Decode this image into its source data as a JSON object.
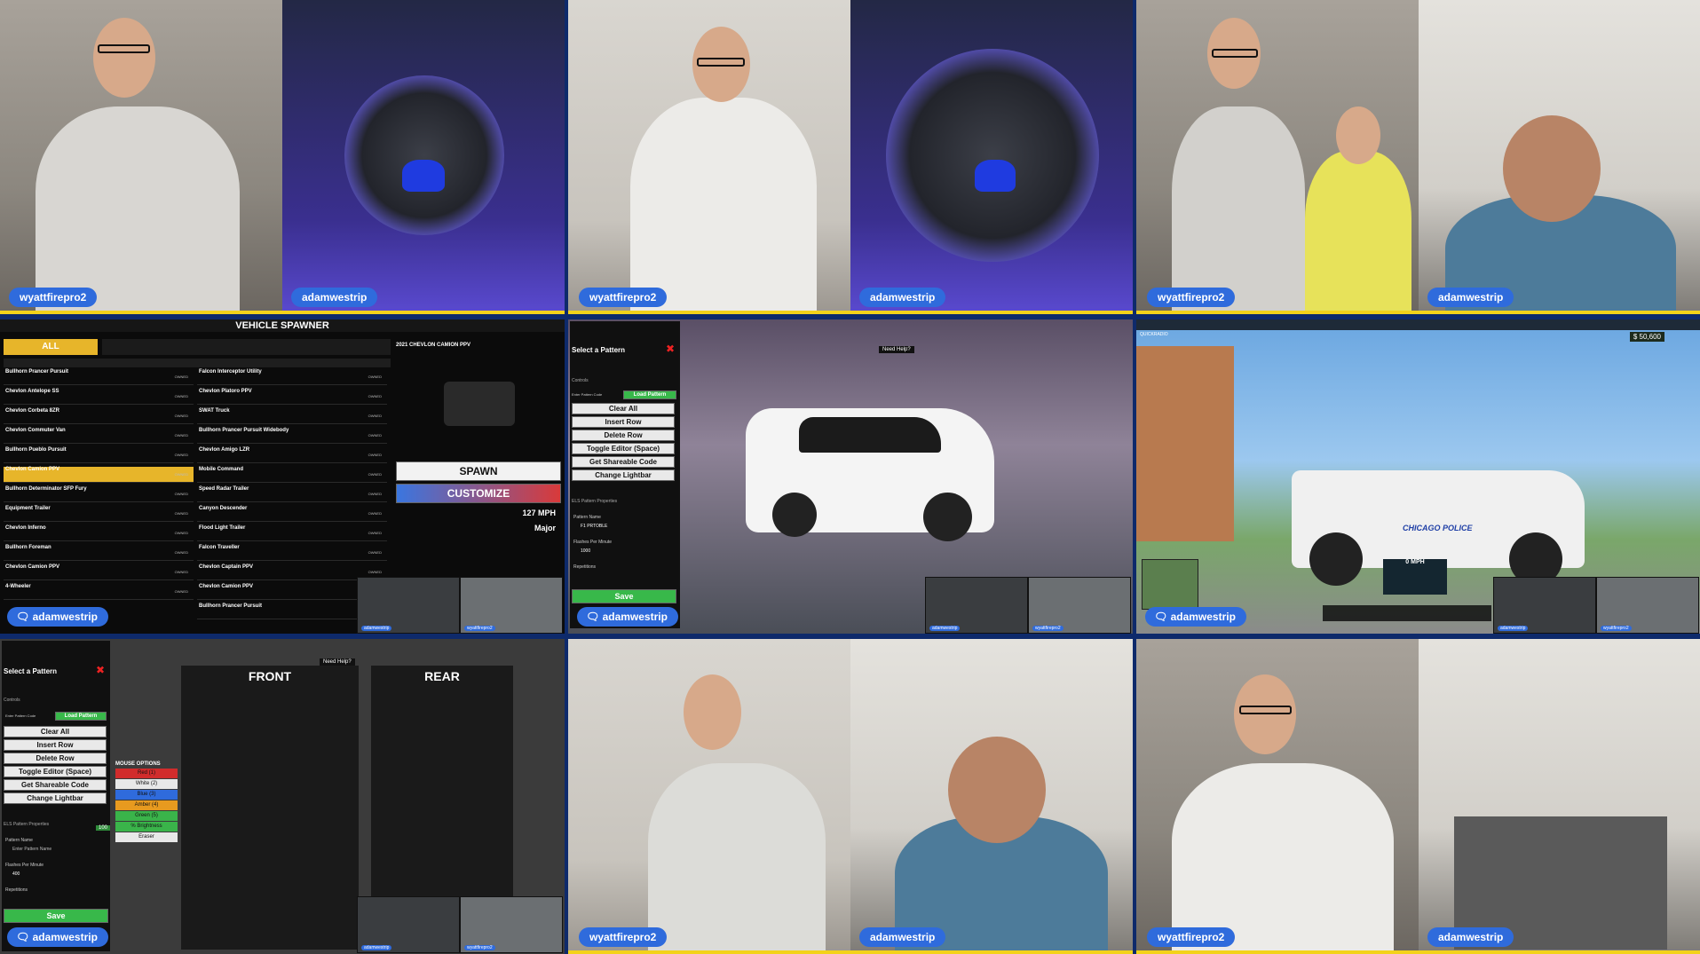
{
  "participants": {
    "p1": "wyattfirepro2",
    "p2": "adamwestrip"
  },
  "spawner": {
    "title": "VEHICLE SPAWNER",
    "tab_all": "ALL",
    "selected_vehicle": "2021 CHEVLON CAMION PPV",
    "spawn_label": "SPAWN",
    "customize_label": "CUSTOMIZE",
    "speed": "127 MPH",
    "class": "Major",
    "owned": "OWNED",
    "left_list": [
      "Bullhorn Prancer Pursuit",
      "Chevlon Antelope SS",
      "Chevlon Corbeta 8ZR",
      "Chevlon Commuter Van",
      "Bullhorn Pueblo Pursuit",
      "Chevlon Camion PPV",
      "Bullhorn Determinator SFP Fury",
      "Equipment Trailer",
      "Chevlon Inferno",
      "Bullhorn Foreman",
      "Chevlon Camion PPV",
      "4-Wheeler"
    ],
    "right_list": [
      "Falcon Interceptor Utility",
      "Chevlon Platoro PPV",
      "SWAT Truck",
      "Bullhorn Prancer Pursuit Widebody",
      "Chevlon Amigo LZR",
      "Mobile Command",
      "Speed Radar Trailer",
      "Canyon Descender",
      "Flood Light Trailer",
      "Falcon Traveller",
      "Chevlon Captain PPV",
      "Chevlon Camion PPV",
      "Bullhorn Prancer Pursuit"
    ]
  },
  "pattern": {
    "select_title": "Select a Pattern",
    "controls": "Controls",
    "enter_code": "Enter Pattern Code",
    "load_pattern": "Load Pattern",
    "buttons": [
      "Clear All",
      "Insert Row",
      "Delete Row",
      "Toggle Editor (Space)",
      "Get Shareable Code",
      "Change Lightbar"
    ],
    "props_title": "ELS Pattern Properties",
    "pattern_name_label": "Pattern Name",
    "pattern_name_value": "F1 PRTOBLE",
    "enter_pattern_name": "Enter Pattern Name",
    "fpm_label": "Flashes Per Minute",
    "fpm_value_a": "1000",
    "fpm_value_b": "400",
    "repetitions": "Repetitions",
    "save": "Save",
    "need_help": "Need Help?",
    "front": "FRONT",
    "rear": "REAR",
    "mouse_options": "MOUSE OPTIONS",
    "colors": [
      "Red (1)",
      "White (2)",
      "Blue (3)",
      "Amber (4)",
      "Green (5)",
      "% Brightness",
      "Eraser"
    ],
    "brightness_value": "100"
  },
  "hud": {
    "money": "$ 50,600",
    "speed": "0 MPH",
    "quickradio": "QUICKRADIO",
    "police_text": "CHICAGO POLICE"
  },
  "colors": {
    "background": "#0e2a6b",
    "accent_yellow": "#f3d21a",
    "badge_blue": "#2f6bdc",
    "spawn_gold": "#e7b52a",
    "customize_gradient": "#3a76e0"
  }
}
